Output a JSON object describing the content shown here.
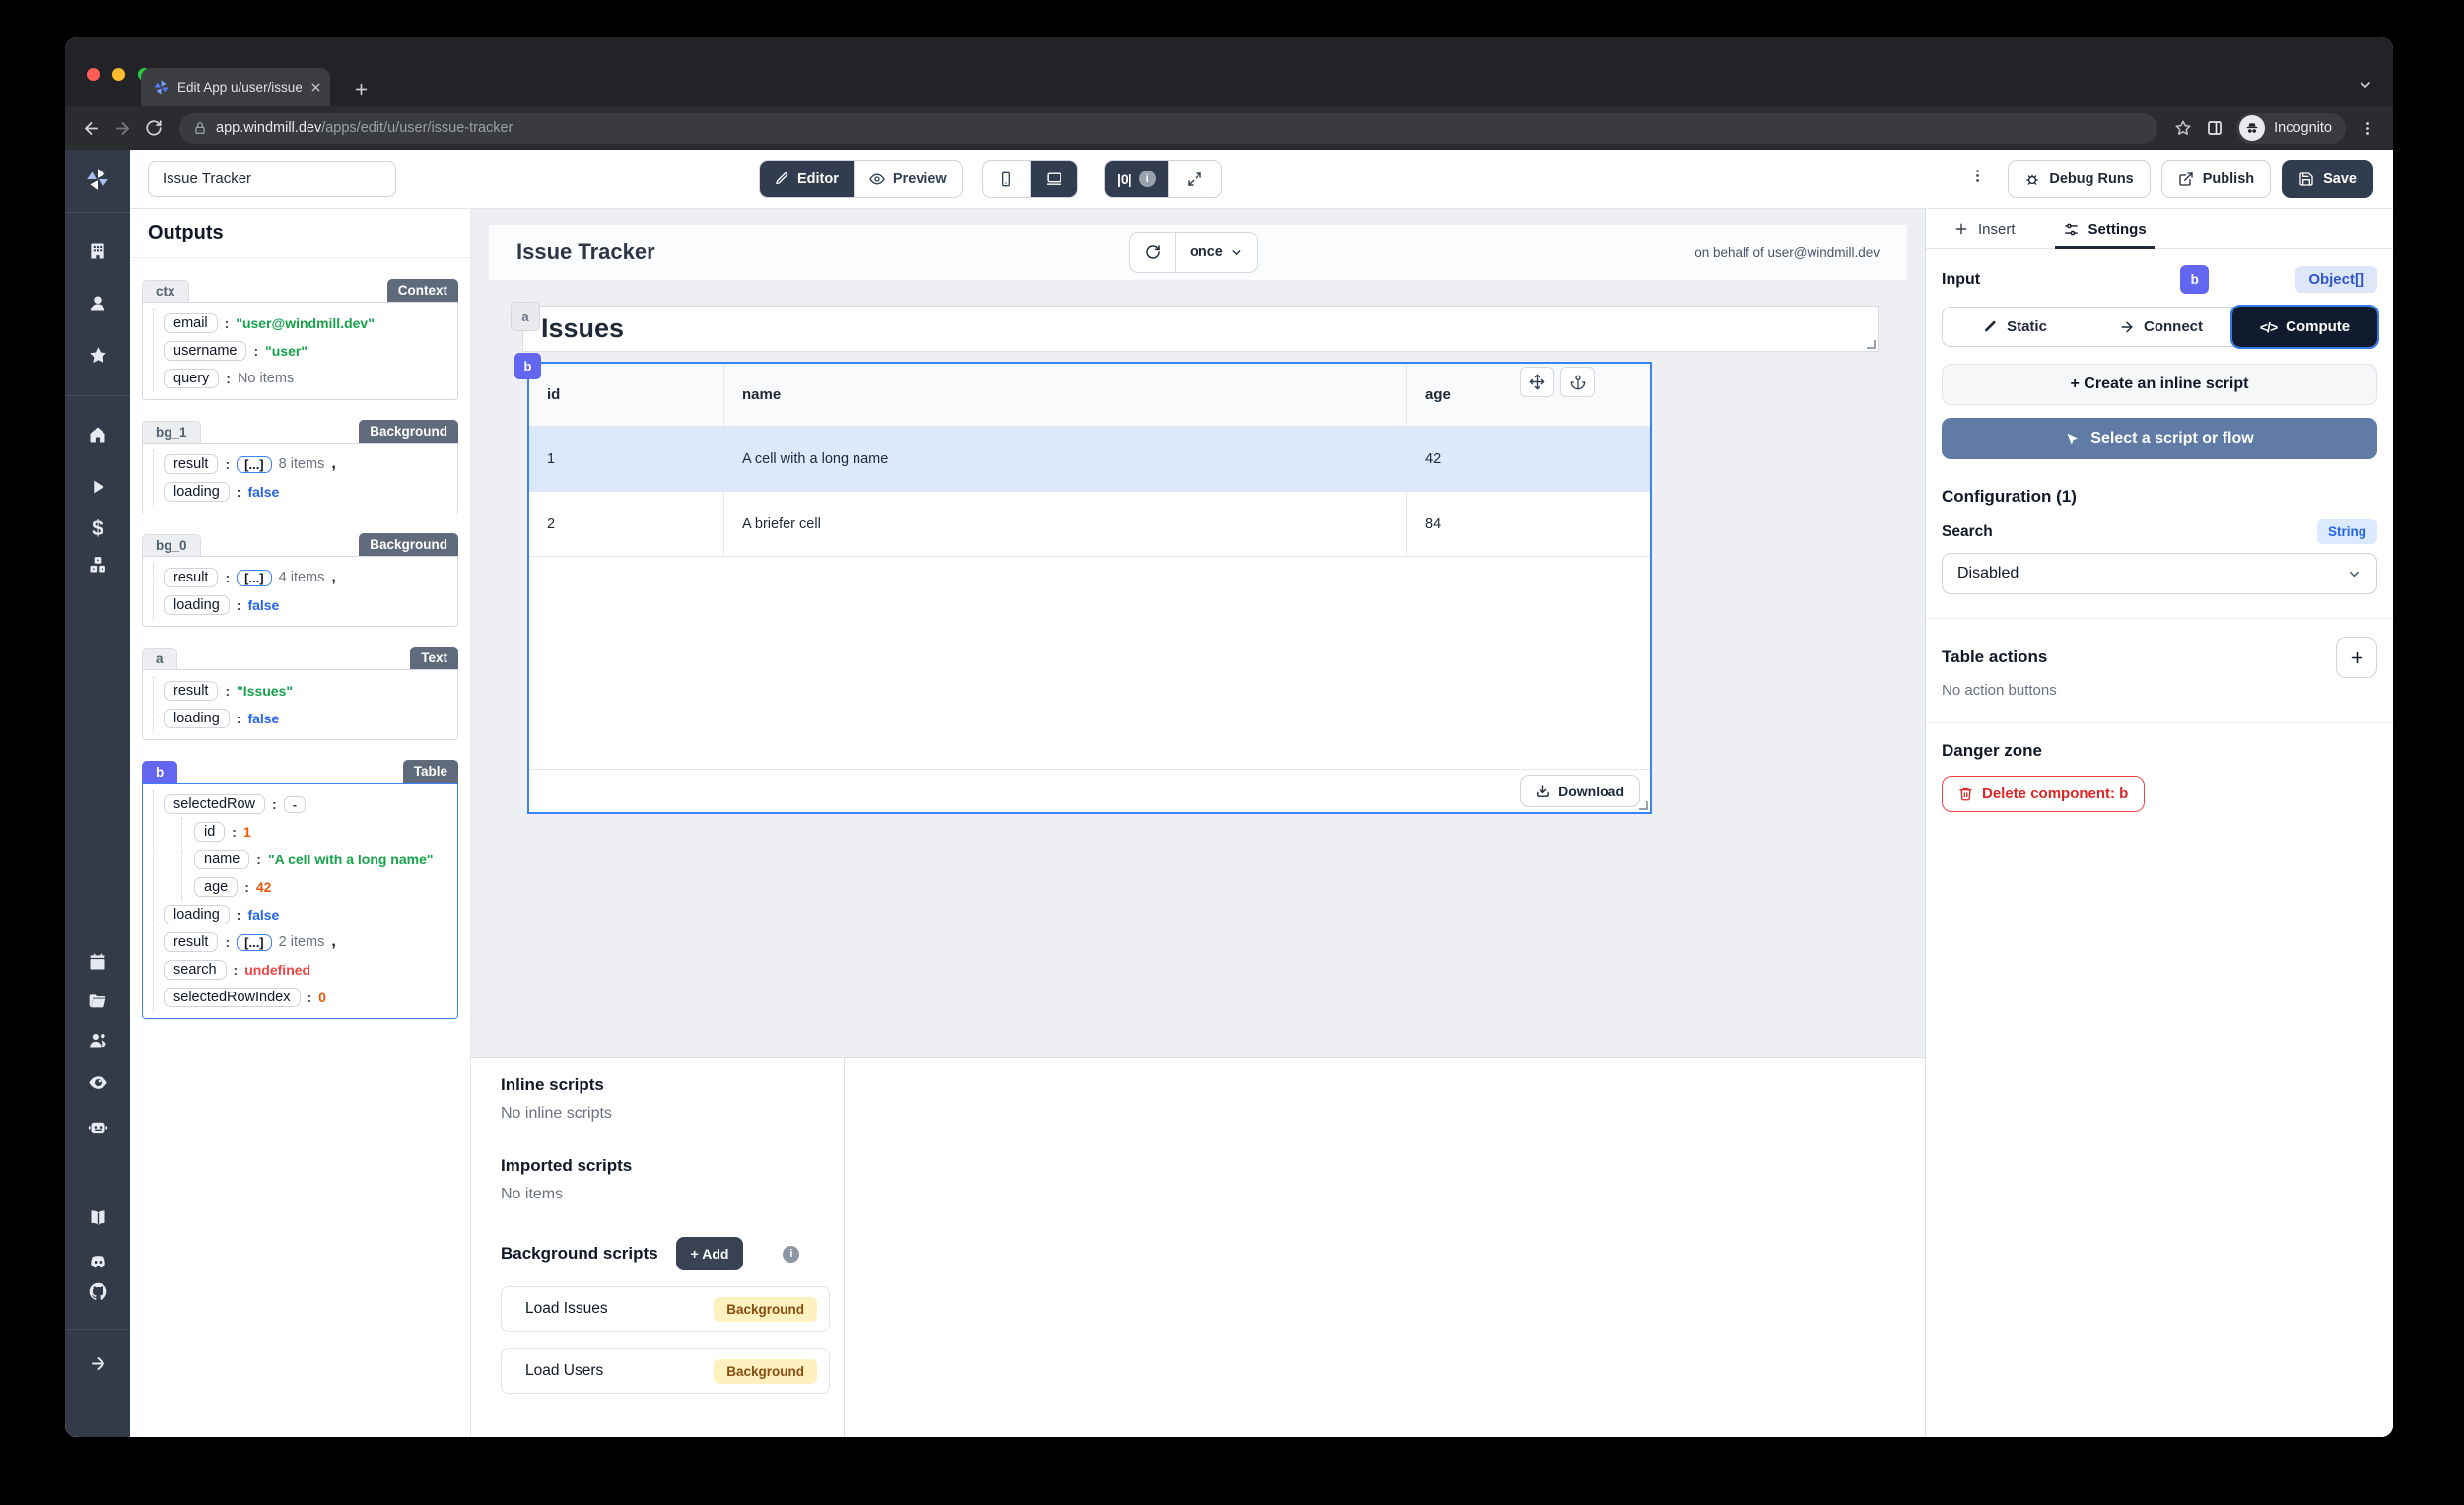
{
  "browser": {
    "tab_title": "Edit App u/user/issue-tracker |",
    "url_host": "app.windmill.dev",
    "url_path": "/apps/edit/u/user/issue-tracker",
    "incognito": "Incognito"
  },
  "toolbar": {
    "app_name": "Issue Tracker",
    "editor": "Editor",
    "preview": "Preview",
    "code_toggle": "|0|",
    "debug": "Debug Runs",
    "publish": "Publish",
    "save": "Save"
  },
  "outputs": {
    "title": "Outputs",
    "sections": [
      {
        "id": "ctx",
        "type": "Context",
        "rows": [
          {
            "k": "email",
            "v": "\"user@windmill.dev\""
          },
          {
            "k": "username",
            "v": "\"user\""
          },
          {
            "k": "query",
            "v": "No items"
          }
        ]
      },
      {
        "id": "bg_1",
        "type": "Background",
        "rows": [
          {
            "k": "result",
            "arr": "[...]",
            "v": "8 items",
            "sep": ","
          },
          {
            "k": "loading",
            "v": "false"
          }
        ]
      },
      {
        "id": "bg_0",
        "type": "Background",
        "rows": [
          {
            "k": "result",
            "arr": "[...]",
            "v": "4 items",
            "sep": ","
          },
          {
            "k": "loading",
            "v": "false"
          }
        ]
      },
      {
        "id": "a",
        "type": "Text",
        "rows": [
          {
            "k": "result",
            "v": "\"Issues\""
          },
          {
            "k": "loading",
            "v": "false"
          }
        ]
      },
      {
        "id": "b",
        "type": "Table",
        "selected_row_key": "selectedRow",
        "selected_row_val": "-",
        "nested": [
          {
            "k": "id",
            "v": "1"
          },
          {
            "k": "name",
            "v": "\"A cell with a long name\""
          },
          {
            "k": "age",
            "v": "42"
          }
        ],
        "rows": [
          {
            "k": "loading",
            "v": "false"
          },
          {
            "k": "result",
            "arr": "[...]",
            "v": "2 items",
            "sep": ","
          },
          {
            "k": "search",
            "v": "undefined"
          },
          {
            "k": "selectedRowIndex",
            "v": "0"
          }
        ]
      }
    ]
  },
  "canvas": {
    "title": "Issue Tracker",
    "run_mode": "once",
    "on_behalf": "on behalf of user@windmill.dev",
    "heading": "Issues",
    "a_chip": "a",
    "b_chip": "b",
    "download": "Download",
    "table": {
      "columns": [
        "id",
        "name",
        "age"
      ],
      "rows": [
        [
          "1",
          "A cell with a long name",
          "42"
        ],
        [
          "2",
          "A briefer cell",
          "84"
        ]
      ]
    }
  },
  "scripts": {
    "inline_title": "Inline scripts",
    "inline_empty": "No inline scripts",
    "imported_title": "Imported scripts",
    "imported_empty": "No items",
    "background_title": "Background scripts",
    "add": "+ Add",
    "info": "i",
    "items": [
      {
        "name": "Load Issues",
        "badge": "Background"
      },
      {
        "name": "Load Users",
        "badge": "Background"
      }
    ]
  },
  "settings": {
    "insert": "Insert",
    "tab": "Settings",
    "input": "Input",
    "component": "b",
    "type": "Object[]",
    "static": "Static",
    "connect": "Connect",
    "compute": "Compute",
    "compute_glyph": "</>",
    "create": "+ Create an inline script",
    "select": "Select a script or flow",
    "config": "Configuration (1)",
    "search": "Search",
    "search_type": "String",
    "search_value": "Disabled",
    "table_actions": "Table actions",
    "no_actions": "No action buttons",
    "danger": "Danger zone",
    "delete": "Delete component: b"
  },
  "colors": {
    "accent_indigo": "#6366f1",
    "selection_blue": "#3b82f6",
    "dark_navy": "#313c4e",
    "string_green": "#16a34a",
    "number_orange": "#e8590c",
    "boolean_blue": "#2563eb",
    "undefined_red": "#ef4444",
    "amber_badge_bg": "#fdf1bf",
    "amber_badge_text": "#8a4b0f",
    "select_script_blue": "#5f7ba6"
  }
}
